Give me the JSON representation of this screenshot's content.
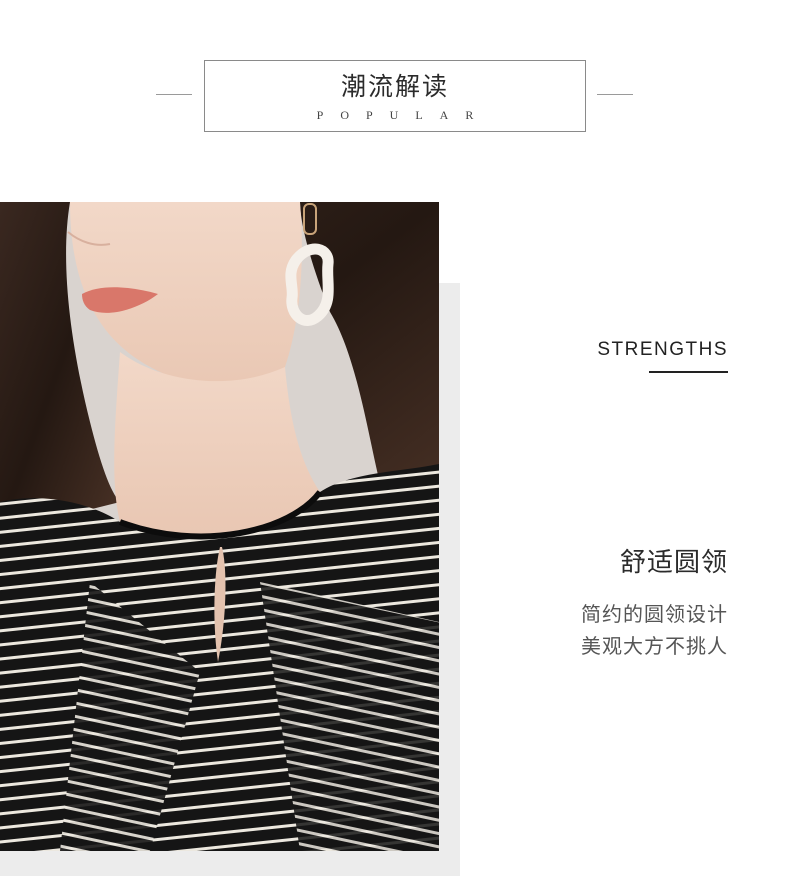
{
  "header": {
    "title": "潮流解读",
    "subtitle": "POPULAR"
  },
  "section": {
    "heading": "STRENGTHS",
    "feature_title": "舒适圆领",
    "feature_desc_line1": "简约的圆领设计",
    "feature_desc_line2": "美观大方不挑人"
  },
  "colors": {
    "panel_gray": "#ececec",
    "text_dark": "#222222",
    "stripe_dark": "#151515",
    "stripe_light": "#ece8df"
  },
  "image": {
    "subject": "model-wearing-striped-round-neck-top"
  }
}
